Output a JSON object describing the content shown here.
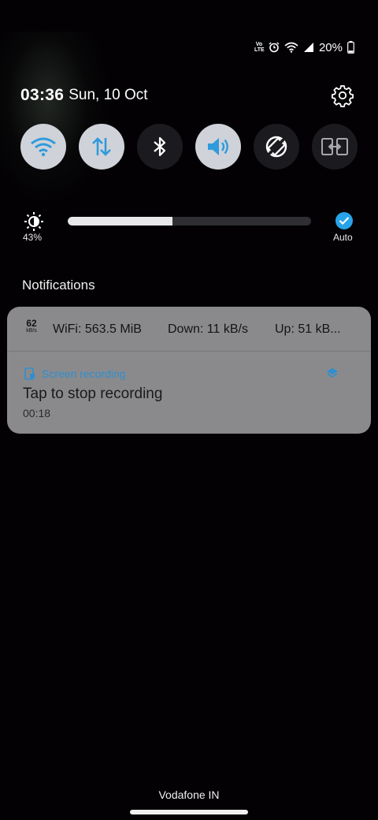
{
  "status_bar": {
    "volte_top": "Vo",
    "volte_bottom": "LTE",
    "battery": "20%",
    "icons": [
      "volte-icon",
      "alarm-icon",
      "wifi-icon",
      "signal-icon",
      "battery-icon"
    ]
  },
  "header": {
    "time": "03:36",
    "date": "Sun, 10 Oct",
    "settings_icon": "gear-icon"
  },
  "quick_toggles": [
    {
      "name": "Wi-Fi",
      "icon": "wifi-icon",
      "state": "on"
    },
    {
      "name": "Mobile data",
      "icon": "data-arrows-icon",
      "state": "on"
    },
    {
      "name": "Bluetooth",
      "icon": "bluetooth-icon",
      "state": "off"
    },
    {
      "name": "Sound",
      "icon": "volume-icon",
      "state": "on"
    },
    {
      "name": "Auto rotate",
      "icon": "rotate-icon",
      "state": "off"
    },
    {
      "name": "Smart View",
      "icon": "screen-mirror-icon",
      "state": "off"
    }
  ],
  "brightness": {
    "percent_label": "43%",
    "level": 0.43,
    "auto_label": "Auto",
    "auto_enabled": true
  },
  "notifications": {
    "section_title": "Notifications",
    "network_speed": {
      "speed_value": "62",
      "speed_unit": "kB/s",
      "wifi": "WiFi: 563.5 MiB",
      "down": "Down: 11 kB/s",
      "up": "Up: 51 kB..."
    },
    "screen_recording": {
      "app_name": "Screen recording",
      "title": "Tap to stop recording",
      "elapsed": "00:18"
    }
  },
  "bottom": {
    "carrier": "Vodafone IN"
  },
  "colors": {
    "background": "#030104",
    "toggle_on": "#cfd2d8",
    "toggle_off": "#1b1b1f",
    "accent_blue": "#29a3e8",
    "panel": "#8a8a8d"
  }
}
